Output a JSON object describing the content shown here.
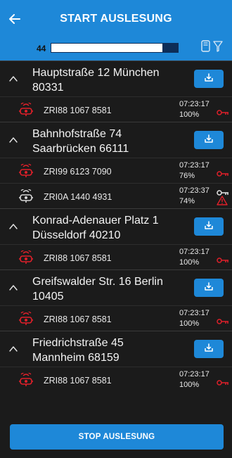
{
  "header": {
    "title": "START AUSLESUNG",
    "back_icon": "arrow-left-icon"
  },
  "progress": {
    "count": "44",
    "fraction": 0.88
  },
  "colors": {
    "accent": "#1e88d8",
    "icon_red": "#e0202a",
    "dark_bg": "#1b1b1b"
  },
  "groups": [
    {
      "address_line1": "Hauptstraße 12 München",
      "address_line2": "80331",
      "meters": [
        {
          "id": "ZRI88 1067 8581",
          "time": "07:23:17",
          "pct": "100%",
          "icon": "red",
          "status": "key-red"
        }
      ]
    },
    {
      "address_line1": "Bahnhofstraße 74",
      "address_line2": "Saarbrücken 66111",
      "meters": [
        {
          "id": "ZRI99 6123 7090",
          "time": "07:23:17",
          "pct": "76%",
          "icon": "red",
          "status": "key-red"
        },
        {
          "id": "ZRI0A 1440 4931",
          "time": "07:23:37",
          "pct": "74%",
          "icon": "grey",
          "status": "key-white-warning"
        }
      ]
    },
    {
      "address_line1": "Konrad-Adenauer Platz 1",
      "address_line2": "Düsseldorf 40210",
      "meters": [
        {
          "id": "ZRI88 1067 8581",
          "time": "07:23:17",
          "pct": "100%",
          "icon": "red",
          "status": "key-red"
        }
      ]
    },
    {
      "address_line1": "Greifswalder Str. 16 Berlin",
      "address_line2": "10405",
      "meters": [
        {
          "id": "ZRI88 1067 8581",
          "time": "07:23:17",
          "pct": "100%",
          "icon": "red",
          "status": "key-red"
        }
      ]
    },
    {
      "address_line1": "Friedrichstraße 45",
      "address_line2": "Mannheim 68159",
      "meters": [
        {
          "id": "ZRI88 1067 8581",
          "time": "07:23:17",
          "pct": "100%",
          "icon": "red",
          "status": "key-red"
        }
      ]
    }
  ],
  "footer": {
    "stop_label": "STOP AUSLESUNG"
  }
}
